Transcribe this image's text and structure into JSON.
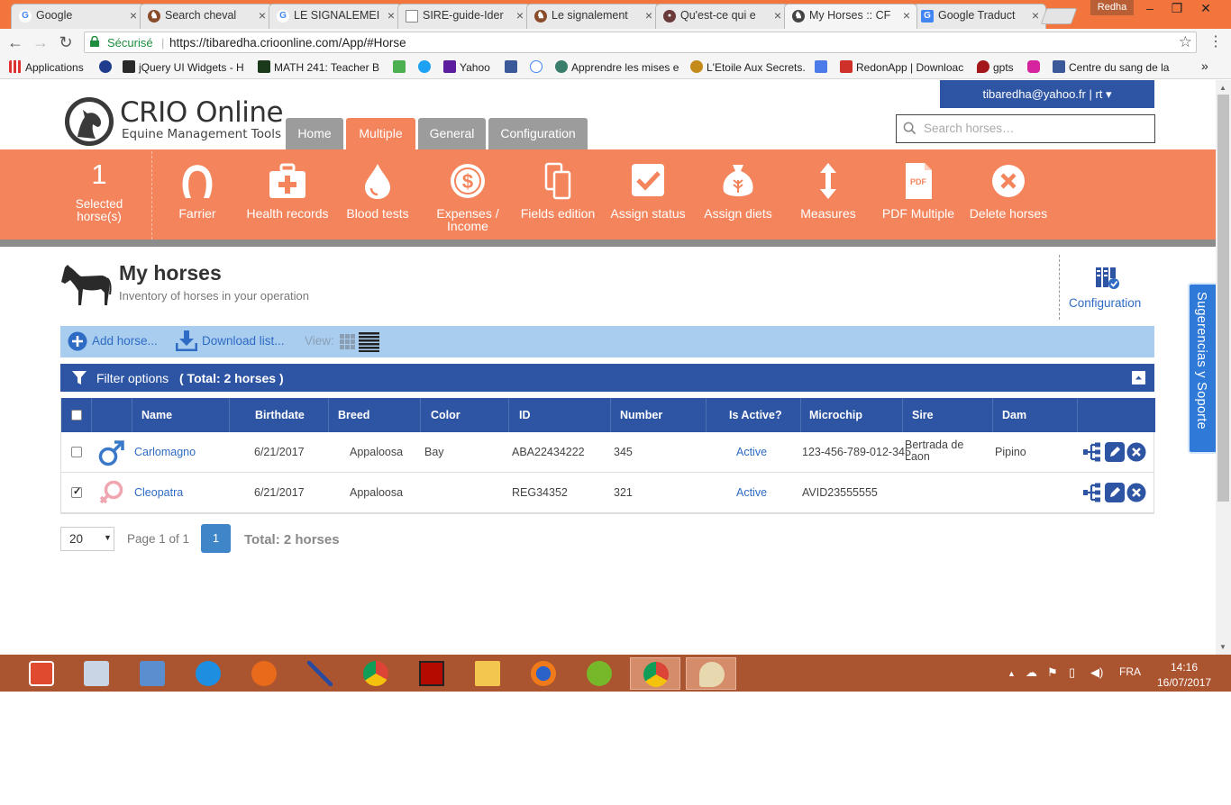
{
  "browser": {
    "tabs": [
      {
        "title": "Google",
        "icon": "google-g-icon"
      },
      {
        "title": "Search cheval",
        "icon": "horse-favicon-icon"
      },
      {
        "title": "LE SIGNALEMEI",
        "icon": "google-g-icon"
      },
      {
        "title": "SIRE-guide-Ider",
        "icon": "document-icon"
      },
      {
        "title": "Le signalement",
        "icon": "horse-favicon-icon"
      },
      {
        "title": "Qu'est-ce qui e",
        "icon": "site-favicon-icon"
      },
      {
        "title": "My Horses :: CF",
        "icon": "crio-favicon-icon"
      },
      {
        "title": "Google Traduct",
        "icon": "translate-icon"
      }
    ],
    "profile_name": "Redha",
    "secure_label": "Sécurisé",
    "url": "https://tibaredha.crioonline.com/App/#Horse",
    "bookmarks": [
      {
        "label": "Applications",
        "icon": "apps-grid-icon"
      },
      {
        "label": "",
        "icon": "bookmark-logo-icon"
      },
      {
        "label": "jQuery UI Widgets - H",
        "icon": "jquery-icon"
      },
      {
        "label": "MATH 241: Teacher B",
        "icon": "math-icon"
      },
      {
        "label": "",
        "icon": "w3-icon"
      },
      {
        "label": "",
        "icon": "twitter-icon"
      },
      {
        "label": "Yahoo",
        "icon": "yahoo-icon"
      },
      {
        "label": "",
        "icon": "facebook-icon"
      },
      {
        "label": "",
        "icon": "google-g-icon"
      },
      {
        "label": "Apprendre les mises e",
        "icon": "globe-icon"
      },
      {
        "label": "L'Etoile Aux Secrets.",
        "icon": "star-icon"
      },
      {
        "label": "",
        "icon": "translate-icon"
      },
      {
        "label": "RedonApp | Downloac",
        "icon": "download-arrow-icon"
      },
      {
        "label": "gpts",
        "icon": "drop-icon"
      },
      {
        "label": "",
        "icon": "instagram-icon"
      },
      {
        "label": "Centre du sang de la",
        "icon": "facebook-icon"
      }
    ],
    "more_bookmarks": "»"
  },
  "app": {
    "logo_title": "CRIO Online",
    "logo_subtitle": "Equine Management Tools",
    "nav_tabs": [
      "Home",
      "Multiple",
      "General",
      "Configuration"
    ],
    "active_tab": "Multiple",
    "account": "tibaredha@yahoo.fr   |   rt ▾",
    "search_placeholder": "Search horses…",
    "selected_count": "1",
    "selected_label": "Selected horse(s)",
    "actions": [
      {
        "label": "Farrier",
        "icon": "horseshoe-icon"
      },
      {
        "label": "Health records",
        "icon": "medical-kit-icon"
      },
      {
        "label": "Blood tests",
        "icon": "blood-drop-icon"
      },
      {
        "label": "Expenses / Income",
        "icon": "dollar-icon"
      },
      {
        "label": "Fields edition",
        "icon": "copy-fields-icon"
      },
      {
        "label": "Assign status",
        "icon": "checkbox-icon"
      },
      {
        "label": "Assign diets",
        "icon": "feed-sack-icon"
      },
      {
        "label": "Measures",
        "icon": "vertical-arrows-icon"
      },
      {
        "label": "PDF Multiple",
        "icon": "pdf-icon"
      },
      {
        "label": "Delete horses",
        "icon": "delete-circle-icon"
      }
    ],
    "pdf_text": "PDF"
  },
  "page": {
    "title": "My horses",
    "subtitle": "Inventory of horses in your operation",
    "config_link": "Configuration",
    "feedback_tab": "Sugerencias y Soporte",
    "toolbar": {
      "add": "Add horse...",
      "download": "Download list...",
      "view_label": "View:"
    },
    "filter": {
      "label": "Filter options",
      "total": "( Total: 2 horses )"
    },
    "table": {
      "headers": [
        "Name",
        "Birthdate",
        "Breed",
        "Color",
        "ID",
        "Number",
        "Is Active?",
        "Microchip",
        "Sire",
        "Dam"
      ],
      "rows": [
        {
          "checked": false,
          "gender": "male",
          "name": "Carlomagno",
          "birthdate": "6/21/2017",
          "breed": "Appaloosa",
          "color": "Bay",
          "id": "ABA22434222",
          "number": "345",
          "active": "Active",
          "microchip": "123-456-789-012-345",
          "sire": "Bertrada de Laon",
          "dam": "Pipino"
        },
        {
          "checked": true,
          "gender": "female",
          "name": "Cleopatra",
          "birthdate": "6/21/2017",
          "breed": "Appaloosa",
          "color": "",
          "id": "REG34352",
          "number": "321",
          "active": "Active",
          "microchip": "AVID23555555",
          "sire": "",
          "dam": ""
        }
      ]
    },
    "pagination": {
      "page_size": "20",
      "page_info": "Page 1 of 1",
      "current_page": "1",
      "total": "Total: 2 horses"
    }
  },
  "taskbar": {
    "apps": [
      "power-icon",
      "calculator-icon",
      "control-panel-icon",
      "ie-icon",
      "nero-icon",
      "tool-icon",
      "chrome-icon",
      "acrobat-icon",
      "file-explorer-icon",
      "firefox-icon",
      "utorrent-icon",
      "chrome-icon",
      "paint-icon"
    ],
    "language": "FRA",
    "time": "14:16",
    "date": "16/07/2017"
  },
  "colors": {
    "accent_orange": "#f4845c",
    "nav_blue": "#2e55a3",
    "link_blue": "#2e6bc4",
    "toolbar_blue": "#a9cdef",
    "male_blue": "#3a78c9",
    "female_pink": "#f0a6b0"
  }
}
